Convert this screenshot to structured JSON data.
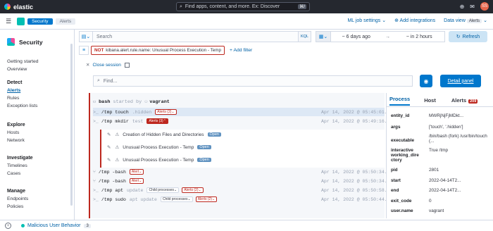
{
  "header": {
    "brand": "elastic",
    "search_placeholder": "Find apps, content, and more. Ex: Discover",
    "search_shortcut": "⌘/",
    "avatar_initials": "SS"
  },
  "breadcrumbs": [
    "Security",
    "Alerts"
  ],
  "header_links": {
    "ml_job_settings": "ML job settings",
    "add_integrations": "Add integrations",
    "data_view_label": "Data view",
    "data_view_value": "Alerts"
  },
  "sidebar": {
    "title": "Security",
    "groups": [
      {
        "head": "",
        "items": [
          "Getting started",
          "Overview"
        ]
      },
      {
        "head": "Detect",
        "items": [
          "Alerts",
          "Rules",
          "Exception lists"
        ]
      },
      {
        "head": "Explore",
        "items": [
          "Hosts",
          "Network"
        ]
      },
      {
        "head": "Investigate",
        "items": [
          "Timelines",
          "Cases"
        ]
      },
      {
        "head": "Manage",
        "items": [
          "Endpoints",
          "Policies"
        ]
      }
    ],
    "active_item": "Alerts"
  },
  "query": {
    "placeholder": "Search",
    "language": "KQL",
    "from": "~ 6 days ago",
    "arrow": "→",
    "to": "~ in 2 hours",
    "refresh": "Refresh"
  },
  "filter": {
    "not": "NOT",
    "text": "kibana.alert.rule.name: Unusual Process Execution - Temp",
    "add": "+ Add filter"
  },
  "session": {
    "close": "Close session",
    "find_placeholder": "Find...",
    "detail_panel": "Detail panel",
    "root_cmd": "bash",
    "started_by": "started by",
    "user": "vagrant"
  },
  "processes": [
    {
      "cmd": "/tmp  touch",
      "arg": ".hidden",
      "badge": "Alerts (2)",
      "badge_style": "outline",
      "ts": "Apr 14, 2022 @ 05:45:01.129",
      "selected": true
    },
    {
      "cmd": "/tmp  mkdir",
      "arg": "test",
      "badge": "Alerts (3)",
      "badge_style": "solid",
      "ts": "Apr 14, 2022 @ 05:49:16.148",
      "selected": false
    },
    {
      "cmd": "/tmp  -bash",
      "arg": "",
      "badge": "Alert",
      "badge_style": "outline",
      "ts": "Apr 14, 2022 @ 05:50:34.611",
      "selected": false
    },
    {
      "cmd": "/tmp  -bash",
      "arg": "",
      "badge": "Alert",
      "badge_style": "outline",
      "ts": "Apr 14, 2022 @ 05:50:34.630",
      "selected": false
    },
    {
      "cmd": "/tmp  apt",
      "arg": "update",
      "child": "Child processes",
      "badge": "Alerts (2)",
      "badge_style": "outline",
      "ts": "Apr 14, 2022 @ 05:50:58.090",
      "selected": false
    },
    {
      "cmd": "/tmp  sudo",
      "arg": "apt update",
      "child": "Child processes",
      "badge": "Alerts (2)",
      "badge_style": "outline",
      "ts": "Apr 14, 2022 @ 05:50:44.950",
      "selected": false
    }
  ],
  "alerts": [
    {
      "name": "Creation of Hidden Files and Directories",
      "status": "Open"
    },
    {
      "name": "Unusual Process Execution - Temp",
      "status": "Open"
    },
    {
      "name": "Unusual Process Execution - Temp",
      "status": "Open"
    }
  ],
  "detail_panel": {
    "tabs": [
      "Process",
      "Host",
      "Alerts"
    ],
    "alerts_count": "209",
    "fields": [
      {
        "k": "entity_id",
        "v": "MWRjNjFjMDkt..."
      },
      {
        "k": "args",
        "v": "['touch', '.hidden']"
      },
      {
        "k": "executable",
        "v": "/bin/bash (fork) /usr/bin/touch (..."
      },
      {
        "k": "interactive working_dire ctory",
        "v": "True /tmp"
      },
      {
        "k": "pid",
        "v": "2801"
      },
      {
        "k": "start",
        "v": "2022-04-14T2..."
      },
      {
        "k": "end",
        "v": "2022-04-14T2..."
      },
      {
        "k": "exit_code",
        "v": "0"
      },
      {
        "k": "user.name",
        "v": "vagrant"
      }
    ]
  },
  "timeline": {
    "label": "Malicious User Behavior",
    "count": "3"
  }
}
